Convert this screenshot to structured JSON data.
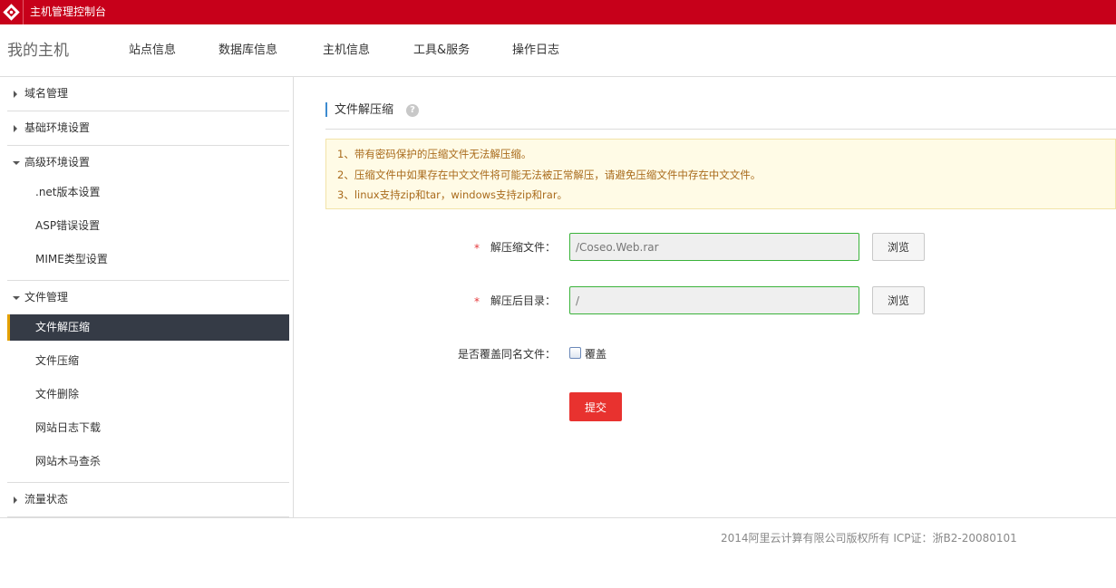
{
  "header": {
    "app_title": "主机管理控制台",
    "logo_icon": "aliyun-logo-icon",
    "bar_color": "#c7001a"
  },
  "nav": {
    "brand": "我的主机",
    "items": [
      {
        "label": "站点信息"
      },
      {
        "label": "数据库信息"
      },
      {
        "label": "主机信息"
      },
      {
        "label": "工具&服务"
      },
      {
        "label": "操作日志"
      }
    ]
  },
  "sidebar": {
    "groups": [
      {
        "label": "域名管理",
        "expanded": false,
        "items": []
      },
      {
        "label": "基础环境设置",
        "expanded": false,
        "items": []
      },
      {
        "label": "高级环境设置",
        "expanded": true,
        "items": [
          {
            "label": ".net版本设置"
          },
          {
            "label": "ASP错误设置"
          },
          {
            "label": "MIME类型设置"
          }
        ]
      },
      {
        "label": "文件管理",
        "expanded": true,
        "items": [
          {
            "label": "文件解压缩",
            "active": true
          },
          {
            "label": "文件压缩"
          },
          {
            "label": "文件删除"
          },
          {
            "label": "网站日志下载"
          },
          {
            "label": "网站木马查杀"
          }
        ]
      },
      {
        "label": "流量状态",
        "expanded": false,
        "items": []
      }
    ]
  },
  "content": {
    "title": "文件解压缩",
    "help_icon": "question-icon",
    "notices": [
      "1、带有密码保护的压缩文件无法解压缩。",
      "2、压缩文件中如果存在中文文件将可能无法被正常解压，请避免压缩文件中存在中文文件。",
      "3、linux支持zip和tar，windows支持zip和rar。"
    ],
    "form": {
      "required_mark": "*",
      "archive_label": "解压缩文件：",
      "archive_value": "/Coseo.Web.rar",
      "target_label": "解压后目录：",
      "target_value": "/",
      "browse_label": "浏览",
      "overwrite_label": "是否覆盖同名文件：",
      "overwrite_option": "覆盖",
      "overwrite_checked": false,
      "submit_label": "提交"
    }
  },
  "footer": {
    "copyright": "2014阿里云计算有限公司版权所有 ICP证：浙B2-20080101"
  }
}
